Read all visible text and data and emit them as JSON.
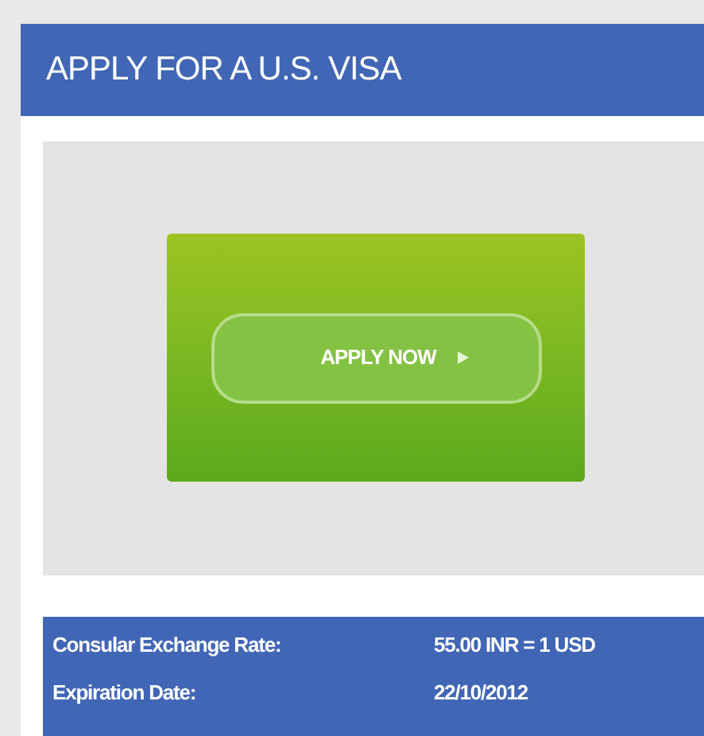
{
  "header": {
    "title": "APPLY FOR A U.S. VISA"
  },
  "apply_button": {
    "label": "APPLY NOW"
  },
  "info": [
    {
      "label": "Consular Exchange Rate:",
      "value": "55.00 INR = 1 USD"
    },
    {
      "label": "Expiration Date:",
      "value": "22/10/2012"
    }
  ]
}
